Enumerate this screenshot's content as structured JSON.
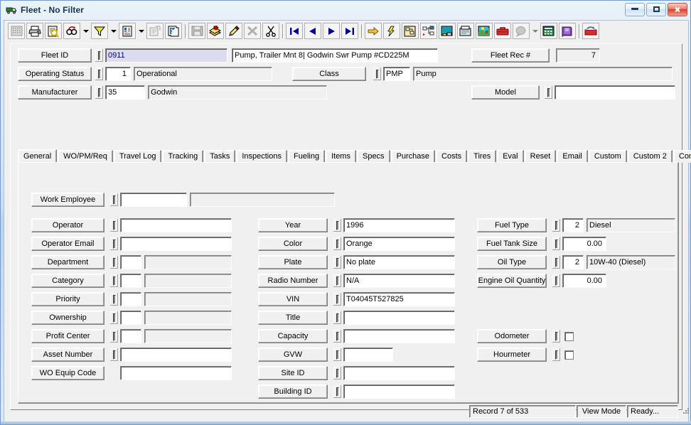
{
  "window": {
    "title": "Fleet - No Filter",
    "icon": "truck-icon",
    "minimize_label": "Minimize",
    "maximize_label": "Maximize",
    "close_label": "Close"
  },
  "toolbar": {
    "buttons": [
      {
        "name": "grid-view-icon",
        "label": "Grid View"
      },
      {
        "name": "print-icon",
        "label": "Print"
      },
      {
        "name": "print-preview-icon",
        "label": "Print Preview"
      },
      {
        "name": "find-icon",
        "label": "Find"
      },
      {
        "name": "find-dropdown-icon",
        "label": "Find Options"
      },
      {
        "name": "filter-icon",
        "label": "Filter"
      },
      {
        "name": "filter-dropdown-icon",
        "label": "Filter Options"
      },
      {
        "name": "report-icon",
        "label": "Report"
      },
      {
        "name": "report-dropdown-icon",
        "label": "Report Options"
      },
      {
        "name": "properties-icon",
        "label": "Properties"
      },
      {
        "name": "copy-record-icon",
        "label": "Copy Record"
      },
      {
        "name": "save-icon",
        "label": "Save"
      },
      {
        "name": "add-record-icon",
        "label": "Add Record"
      },
      {
        "name": "edit-icon",
        "label": "Edit"
      },
      {
        "name": "delete-icon",
        "label": "Delete"
      },
      {
        "name": "cut-icon",
        "label": "Cut"
      },
      {
        "name": "first-record-icon",
        "label": "First Record"
      },
      {
        "name": "previous-record-icon",
        "label": "Previous Record"
      },
      {
        "name": "next-record-icon",
        "label": "Next Record"
      },
      {
        "name": "last-record-icon",
        "label": "Last Record"
      },
      {
        "name": "goto-icon",
        "label": "Go To"
      },
      {
        "name": "quick-action-icon",
        "label": "Quick Action"
      },
      {
        "name": "schematic-icon",
        "label": "Schematic"
      },
      {
        "name": "hierarchy-icon",
        "label": "Hierarchy"
      },
      {
        "name": "workorder-icon",
        "label": "Work Order"
      },
      {
        "name": "fax-icon",
        "label": "Fax"
      },
      {
        "name": "map-icon",
        "label": "Map"
      },
      {
        "name": "toolbox-icon",
        "label": "Toolbox"
      },
      {
        "name": "help-balloon-icon",
        "label": "Help"
      },
      {
        "name": "help-dropdown-icon",
        "label": "Help Options"
      },
      {
        "name": "calculator-icon",
        "label": "Calculator"
      },
      {
        "name": "manual-icon",
        "label": "Manual"
      },
      {
        "name": "exit-icon",
        "label": "Exit"
      }
    ]
  },
  "header": {
    "fleet_id": {
      "label": "Fleet ID",
      "value": "0911"
    },
    "description": {
      "value": "Pump, Trailer Mnt 8| Godwin Swr Pump #CD225M"
    },
    "fleet_rec": {
      "label": "Fleet Rec #",
      "value": "7"
    },
    "operating_status": {
      "label": "Operating Status",
      "code": "1",
      "value": "Operational"
    },
    "class": {
      "label": "Class",
      "code": "PMP",
      "value": "Pump"
    },
    "manufacturer": {
      "label": "Manufacturer",
      "code": "35",
      "value": "Godwin"
    },
    "model": {
      "label": "Model",
      "value": ""
    }
  },
  "tabs": [
    {
      "label": "General",
      "active": true
    },
    {
      "label": "WO/PM/Req",
      "active": false
    },
    {
      "label": "Travel Log",
      "active": false
    },
    {
      "label": "Tracking",
      "active": false
    },
    {
      "label": "Tasks",
      "active": false
    },
    {
      "label": "Inspections",
      "active": false
    },
    {
      "label": "Fueling",
      "active": false
    },
    {
      "label": "Items",
      "active": false
    },
    {
      "label": "Specs",
      "active": false
    },
    {
      "label": "Purchase",
      "active": false
    },
    {
      "label": "Costs",
      "active": false
    },
    {
      "label": "Tires",
      "active": false
    },
    {
      "label": "Eval",
      "active": false
    },
    {
      "label": "Reset",
      "active": false
    },
    {
      "label": "Email",
      "active": false
    },
    {
      "label": "Custom",
      "active": false
    },
    {
      "label": "Custom 2",
      "active": false
    },
    {
      "label": "Comments",
      "active": false
    }
  ],
  "general": {
    "work_employee": {
      "label": "Work Employee",
      "code": "",
      "value": ""
    },
    "left_column": [
      {
        "label": "Operator",
        "code": null,
        "value": ""
      },
      {
        "label": "Operator Email",
        "code": null,
        "value": ""
      },
      {
        "label": "Department",
        "code": "",
        "value": ""
      },
      {
        "label": "Category",
        "code": "",
        "value": ""
      },
      {
        "label": "Priority",
        "code": "",
        "value": ""
      },
      {
        "label": "Ownership",
        "code": "",
        "value": ""
      },
      {
        "label": "Profit Center",
        "code": "",
        "value": ""
      },
      {
        "label": "Asset Number",
        "code": null,
        "value": ""
      },
      {
        "label": "WO Equip Code",
        "code": null,
        "value": ""
      }
    ],
    "middle_column": [
      {
        "label": "Year",
        "value": "1996"
      },
      {
        "label": "Color",
        "value": "Orange"
      },
      {
        "label": "Plate",
        "value": "No plate"
      },
      {
        "label": "Radio Number",
        "value": "N/A"
      },
      {
        "label": "VIN",
        "value": "T04045T527825"
      },
      {
        "label": "Title",
        "value": ""
      },
      {
        "label": "Capacity",
        "value": ""
      },
      {
        "label": "GVW",
        "value": ""
      },
      {
        "label": "Site ID",
        "value": ""
      },
      {
        "label": "Building ID",
        "value": ""
      }
    ],
    "right_column": [
      {
        "label": "Fuel Type",
        "code": "2",
        "value": "Diesel"
      },
      {
        "label": "Fuel Tank Size",
        "code": null,
        "value": "0.00"
      },
      {
        "label": "Oil Type",
        "code": "2",
        "value": "10W-40 (Diesel)"
      },
      {
        "label": "Engine Oil Quantity",
        "code": null,
        "value": "0.00"
      }
    ],
    "meters": [
      {
        "label": "Odometer",
        "checked": false
      },
      {
        "label": "Hourmeter",
        "checked": false
      }
    ]
  },
  "statusbar": {
    "record": "Record 7 of 533",
    "mode": "View Mode",
    "state": "Ready..."
  },
  "colors": {
    "title_accent": "#16324f",
    "face": "#f0f0f0",
    "field_highlight_bg": "#dcdcf0",
    "field_highlight_fg": "#00008b",
    "close_button": "#d8402c"
  }
}
